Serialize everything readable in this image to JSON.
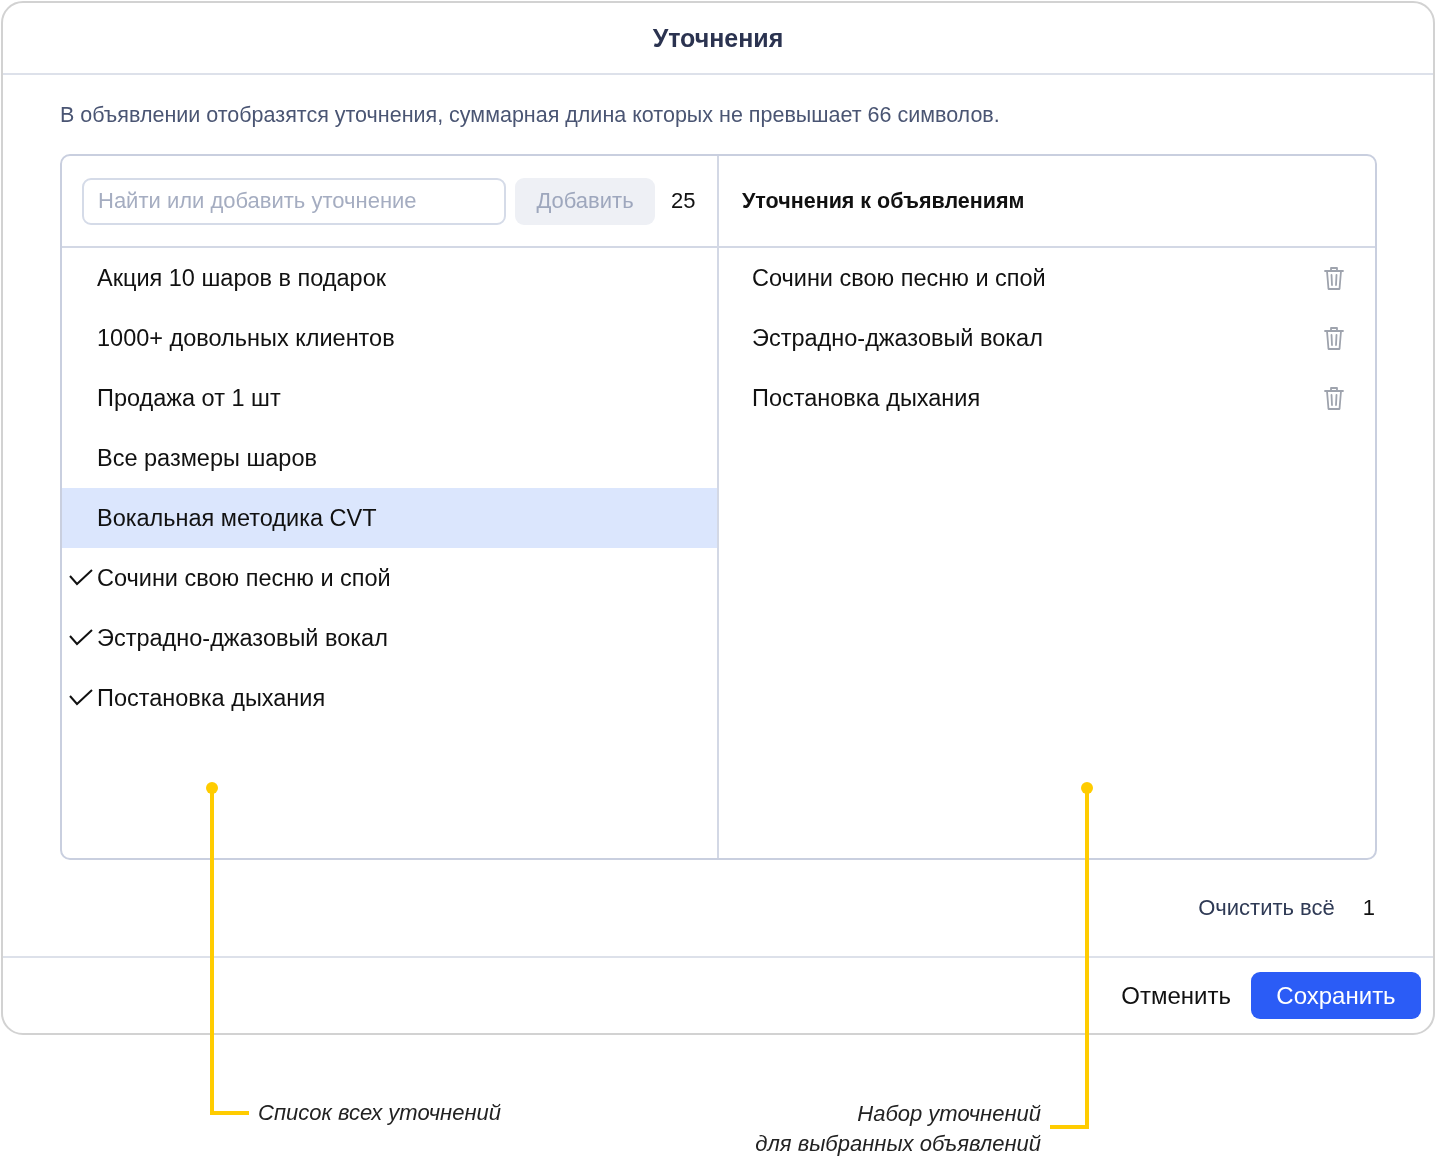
{
  "dialog": {
    "title": "Уточнения",
    "description": "В объявлении отобразятся уточнения, суммарная длина которых не превышает 66 символов.",
    "search": {
      "placeholder": "Найти или добавить уточнение"
    },
    "add_button": "Добавить",
    "count": "25",
    "all_list": [
      {
        "label": "Акция 10 шаров в подарок",
        "selected": false,
        "checked": false
      },
      {
        "label": "1000+ довольных клиентов",
        "selected": false,
        "checked": false
      },
      {
        "label": "Продажа от 1 шт",
        "selected": false,
        "checked": false
      },
      {
        "label": "Все размеры шаров",
        "selected": false,
        "checked": false
      },
      {
        "label": "Вокальная методика CVT",
        "selected": true,
        "checked": false
      },
      {
        "label": "Сочини свою песню и спой",
        "selected": false,
        "checked": true
      },
      {
        "label": "Эстрадно-джазовый вокал",
        "selected": false,
        "checked": true
      },
      {
        "label": "Постановка дыхания",
        "selected": false,
        "checked": true
      }
    ],
    "chosen_header": "Уточнения к объявлениям",
    "chosen_list": [
      {
        "label": "Сочини свою песню и спой"
      },
      {
        "label": "Эстрадно-джазовый вокал"
      },
      {
        "label": "Постановка дыхания"
      }
    ],
    "clear_all": "Очистить всё",
    "clear_count": "1",
    "buttons": [
      {
        "label": "Отменить",
        "kind": "secondary"
      },
      {
        "label": "Сохранить",
        "kind": "primary"
      }
    ]
  },
  "annotations": [
    {
      "lines": [
        "Список всех уточнений"
      ]
    },
    {
      "lines": [
        "Набор уточнений",
        "для выбранных объявлений"
      ]
    }
  ]
}
